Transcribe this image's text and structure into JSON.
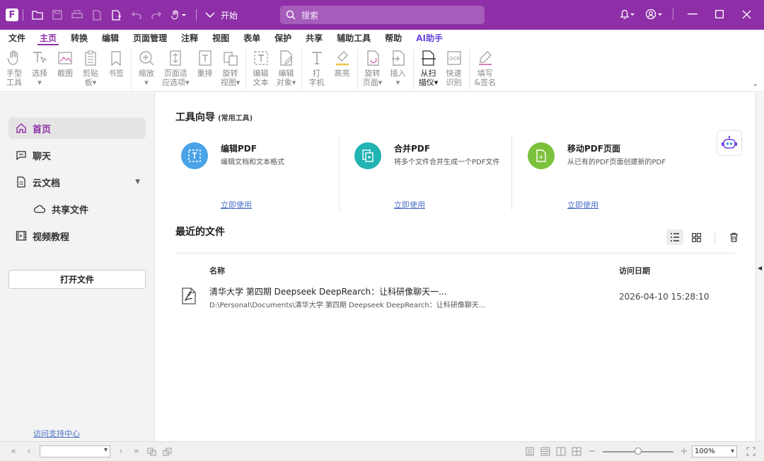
{
  "titlebar": {
    "start_label": "开始",
    "search_placeholder": "搜索",
    "accent": "#8e2fa7"
  },
  "menu": [
    {
      "label": "文件"
    },
    {
      "label": "主页",
      "active": true
    },
    {
      "label": "转换"
    },
    {
      "label": "编辑"
    },
    {
      "label": "页面管理"
    },
    {
      "label": "注释"
    },
    {
      "label": "视图"
    },
    {
      "label": "表单"
    },
    {
      "label": "保护"
    },
    {
      "label": "共享"
    },
    {
      "label": "辅助工具"
    },
    {
      "label": "帮助"
    },
    {
      "label": "AI助手"
    }
  ],
  "ribbon": [
    {
      "line1": "手型",
      "line2": "工具",
      "icon": "hand-icon"
    },
    {
      "line1": "选择",
      "line2": "▾",
      "icon": "select-icon"
    },
    {
      "line1": "截图",
      "line2": "",
      "icon": "screenshot-icon"
    },
    {
      "line1": "剪贴",
      "line2": "板▾",
      "icon": "clipboard-icon"
    },
    {
      "line1": "书签",
      "line2": "",
      "icon": "bookmark-icon"
    },
    {
      "line1": "缩放",
      "line2": "▾",
      "icon": "zoom-icon"
    },
    {
      "line1": "页面适",
      "line2": "应选项▾",
      "icon": "fit-page-icon"
    },
    {
      "line1": "重排",
      "line2": "",
      "icon": "reflow-icon"
    },
    {
      "line1": "旋转",
      "line2": "视图▾",
      "icon": "rotate-view-icon"
    },
    {
      "line1": "编辑",
      "line2": "文本",
      "icon": "edit-text-icon"
    },
    {
      "line1": "编辑",
      "line2": "对象▾",
      "icon": "edit-object-icon"
    },
    {
      "line1": "打",
      "line2": "字机",
      "icon": "typewriter-icon"
    },
    {
      "line1": "高亮",
      "line2": "",
      "icon": "highlight-icon"
    },
    {
      "line1": "旋转",
      "line2": "页面▾",
      "icon": "rotate-page-icon"
    },
    {
      "line1": "插入",
      "line2": "▾",
      "icon": "insert-icon"
    },
    {
      "line1": "从扫",
      "line2": "描仪▾",
      "icon": "scanner-icon"
    },
    {
      "line1": "快速",
      "line2": "识别",
      "icon": "ocr-icon"
    },
    {
      "line1": "填写",
      "line2": "&签名",
      "icon": "fill-sign-icon"
    }
  ],
  "sidebar": {
    "items": [
      {
        "label": "首页",
        "icon": "home-icon"
      },
      {
        "label": "聊天",
        "icon": "chat-icon"
      },
      {
        "label": "云文档",
        "icon": "cloud-doc-icon"
      },
      {
        "label": "共享文件",
        "icon": "cloud-icon"
      },
      {
        "label": "视频教程",
        "icon": "video-icon"
      }
    ],
    "open_file": "打开文件",
    "support_link": "访问支持中心"
  },
  "main": {
    "tools_title": "工具向导",
    "tools_subtitle": "(常用工具)",
    "tools": [
      {
        "title": "编辑PDF",
        "desc": "编辑文档和文本格式",
        "link": "立即使用",
        "color": "#4aa3e8",
        "icon": "edit-pdf-icon"
      },
      {
        "title": "合并PDF",
        "desc": "将多个文件合并生成一个PDF文件",
        "link": "立即使用",
        "color": "#22b3b3",
        "icon": "merge-pdf-icon"
      },
      {
        "title": "移动PDF页面",
        "desc": "从已有的PDF页面创建新的PDF",
        "link": "立即使用",
        "color": "#7cc13b",
        "icon": "move-pages-icon"
      }
    ],
    "recent_title": "最近的文件",
    "columns": {
      "name": "名称",
      "date": "访问日期"
    },
    "files": [
      {
        "name": "清华大学 第四期 Deepseek DeepRearch：让科研像聊天一...",
        "path": "D:\\Personal\\Documents\\清华大学 第四期 Deepseek DeepRearch：让科研像聊天...",
        "date": "2026-04-10 15:28:10"
      }
    ]
  },
  "status": {
    "zoom": "100%",
    "zoom_level": 0.5
  }
}
